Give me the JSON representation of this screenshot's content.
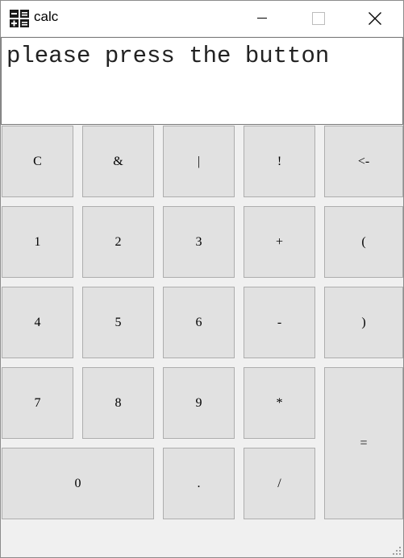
{
  "window": {
    "title": "calc"
  },
  "display": {
    "text": "please press the button"
  },
  "keys": {
    "clear": "C",
    "and": "&",
    "or": "|",
    "not": "!",
    "backspace": "<-",
    "one": "1",
    "two": "2",
    "three": "3",
    "plus": "+",
    "lparen": "(",
    "four": "4",
    "five": "5",
    "six": "6",
    "minus": "-",
    "rparen": ")",
    "seven": "7",
    "eight": "8",
    "nine": "9",
    "multiply": "*",
    "equals": "=",
    "zero": "0",
    "dot": ".",
    "divide": "/"
  },
  "icons": {
    "app": "calculator-icon",
    "minimize": "minimize-icon",
    "maximize": "maximize-icon",
    "close": "close-icon",
    "resize": "resize-grip-icon"
  }
}
